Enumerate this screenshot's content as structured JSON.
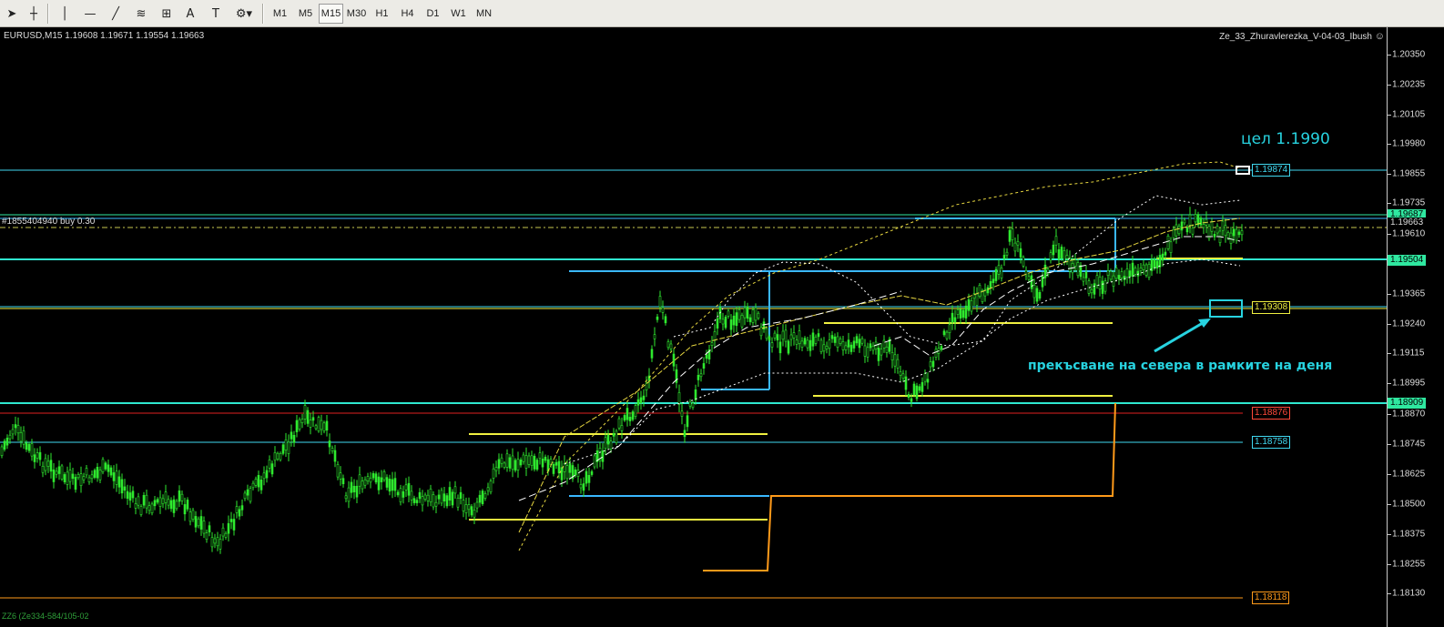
{
  "toolbar": {
    "tools": [
      {
        "name": "cursor-icon",
        "glyph": "➤"
      },
      {
        "name": "crosshair-icon",
        "glyph": "┼"
      },
      {
        "name": "vertical-line-icon",
        "glyph": "│"
      },
      {
        "name": "horizontal-line-icon",
        "glyph": "—"
      },
      {
        "name": "trendline-icon",
        "glyph": "╱"
      },
      {
        "name": "fibonacci-icon",
        "glyph": "≋"
      },
      {
        "name": "fibonacci-fan-icon",
        "glyph": "⊞"
      },
      {
        "name": "text-tool-icon",
        "glyph": "A"
      },
      {
        "name": "text-label-icon",
        "glyph": "T"
      },
      {
        "name": "shapes-dropdown-icon",
        "glyph": "⚙▾"
      }
    ],
    "timeframes": [
      "M1",
      "M5",
      "M15",
      "M30",
      "H1",
      "H4",
      "D1",
      "W1",
      "MN"
    ],
    "active_timeframe": "M15"
  },
  "chart_header": {
    "symbol_info": "EURUSD,M15  1.19608 1.19671 1.19554 1.19663",
    "indicator_name": "Ze_33_Zhuravlerezka_V-04-03_Ibush",
    "order_label": "#1855404940 buy 0.30",
    "bottom_label": "ZZ6 (Ze334-584/105-02"
  },
  "price_axis": {
    "ticks": [
      "1.20350",
      "1.20235",
      "1.20105",
      "1.19980",
      "1.19855",
      "1.19735",
      "1.19610",
      "1.19485",
      "1.19365",
      "1.19240",
      "1.19115",
      "1.18995",
      "1.18870",
      "1.18745",
      "1.18625",
      "1.18500",
      "1.18375",
      "1.18255",
      "1.18130"
    ],
    "flags": [
      {
        "text": "1.19687",
        "bg": "#2fe8a0",
        "fg": "#000"
      },
      {
        "text": "1.19663",
        "bg": "#000",
        "fg": "#ddd"
      },
      {
        "text": "1.19504",
        "bg": "#2fe8a0",
        "fg": "#000"
      },
      {
        "text": "1.18909",
        "bg": "#2fe8a0",
        "fg": "#000"
      }
    ]
  },
  "level_labels": [
    {
      "text": "1.19874",
      "color": "#40d8f0"
    },
    {
      "text": "1.19308",
      "color": "#f0f040"
    },
    {
      "text": "1.18876",
      "color": "#ff4a3a"
    },
    {
      "text": "1.18758",
      "color": "#40d8f0"
    },
    {
      "text": "1.18118",
      "color": "#ff9a1a"
    }
  ],
  "annotations": {
    "target": "цел 1.1990",
    "breakout": "прекъсване на севера в рамките на деня"
  },
  "colors": {
    "background": "#000000",
    "candles": "#2fe82f",
    "aqua_level": "#2fe8d0",
    "cyan_box": "#3ab8ff",
    "yellow_box": "#f0f040",
    "orange_line": "#ff9a1a",
    "red_line": "#e02020"
  }
}
